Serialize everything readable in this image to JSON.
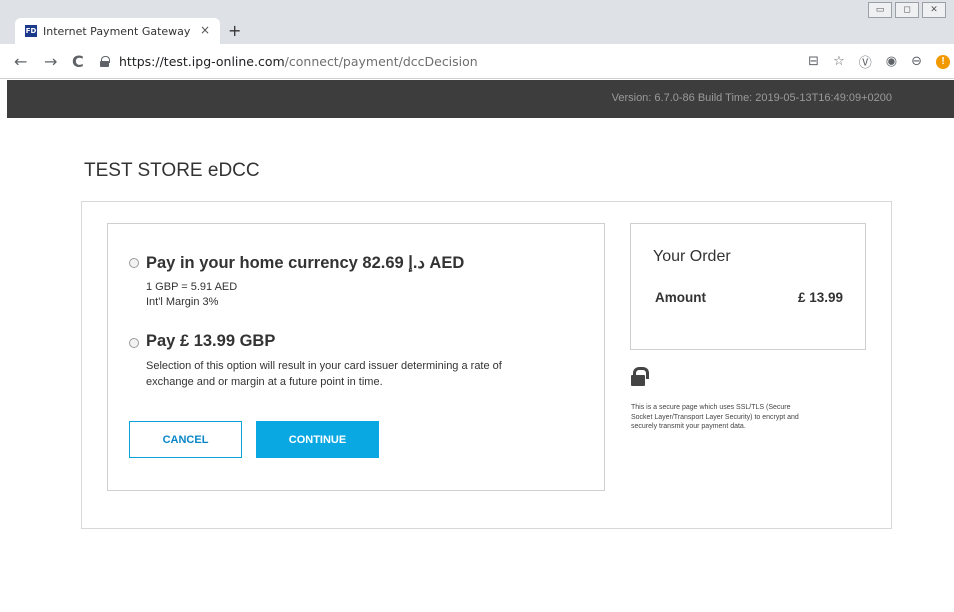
{
  "browser": {
    "tab_title": "Internet Payment Gateway",
    "tab_close": "×",
    "new_tab": "+",
    "favicon_text": "FD",
    "url_host": "https://test.ipg-online.com",
    "url_path": "/connect/payment/dccDecision",
    "back": "←",
    "forward": "→",
    "reload": "C"
  },
  "header": {
    "version_text": "Version: 6.7.0-86 Build Time: 2019-05-13T16:49:09+0200"
  },
  "page": {
    "store_title": "TEST STORE eDCC"
  },
  "options": {
    "home_currency": {
      "title": "Pay in your home currency 82.69 د.إ AED",
      "rate": "1 GBP = 5.91 AED",
      "margin": "Int'l Margin 3%"
    },
    "gbp": {
      "title": "Pay £ 13.99 GBP",
      "note_line1": "Selection of this option will result in your card issuer determining a rate of",
      "note_line2": "exchange and or margin at a future point in time."
    }
  },
  "buttons": {
    "cancel": "CANCEL",
    "continue": "CONTINUE"
  },
  "order": {
    "title": "Your Order",
    "amount_label": "Amount",
    "amount_value": "£ 13.99"
  },
  "security": {
    "line1": "This is a secure page which uses SSL/TLS (Secure",
    "line2": "Socket Layer/Transport Layer Security) to encrypt and",
    "line3": "securely transmit your payment data."
  },
  "colors": {
    "header_bg": "#3d3d3d",
    "accent": "#0aa8e3"
  }
}
